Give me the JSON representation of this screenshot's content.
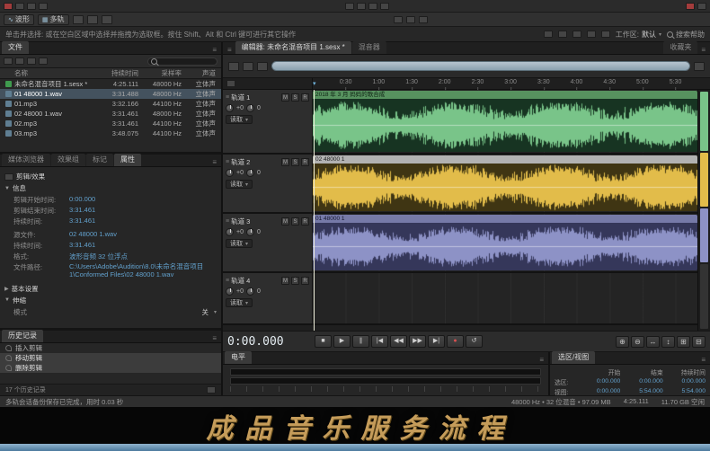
{
  "icons": {
    "menu": "≡",
    "dropdown": "▾",
    "tri_open": "▼",
    "tri_closed": "▶",
    "stop": "■",
    "play": "▶",
    "pause": "∥",
    "skip_back": "|◀",
    "rewind": "◀◀",
    "forward": "▶▶",
    "skip_end": "▶|",
    "record": "●",
    "loop": "↺",
    "zoom_in": "⊕",
    "zoom_out": "⊖",
    "zoom_h": "↔",
    "zoom_v": "↕",
    "zoom_sel_in": "⊞",
    "zoom_sel_out": "⊟",
    "cti_marker": "▾",
    "waveform_glyph": "∿"
  },
  "topbar": {
    "waveform_label": "波形",
    "multitrack_label": "多轨"
  },
  "instruction_bar": {
    "text": "单击并选择: 或在空白区域中选择并拖拽为选取框。按住 Shift、Alt 和 Ctrl 键可进行其它操作",
    "workspace_label": "工作区:",
    "workspace_value": "默认",
    "search_help": "搜索帮助"
  },
  "files_panel": {
    "tab": "文件",
    "columns": {
      "name": "名称",
      "duration": "持续时间",
      "rate": "采样率",
      "channels": "声道"
    },
    "rows": [
      {
        "name": "未命名混音项目 1.sesx *",
        "duration": "4:25.111",
        "rate": "48000 Hz",
        "channels": "立体声"
      },
      {
        "name": "01 48000 1.wav",
        "duration": "3:31.488",
        "rate": "48000 Hz",
        "channels": "立体声"
      },
      {
        "name": "01.mp3",
        "duration": "3:32.166",
        "rate": "44100 Hz",
        "channels": "立体声"
      },
      {
        "name": "02 48000 1.wav",
        "duration": "3:31.461",
        "rate": "48000 Hz",
        "channels": "立体声"
      },
      {
        "name": "02.mp3",
        "duration": "3:31.461",
        "rate": "44100 Hz",
        "channels": "立体声"
      },
      {
        "name": "03.mp3",
        "duration": "3:48.075",
        "rate": "44100 Hz",
        "channels": "立体声"
      }
    ]
  },
  "properties_panel": {
    "tabs": [
      "媒体浏览器",
      "效果组",
      "标记",
      "属性"
    ],
    "header": "剪辑/效果",
    "info_section": "信息",
    "fields": {
      "clip_start_label": "剪辑开始时间:",
      "clip_start": "0:00.000",
      "clip_end_label": "剪辑结束时间:",
      "clip_end": "3:31.461",
      "clip_dur_label": "持续时间:",
      "clip_dur": "3:31.461",
      "source_label": "源文件:",
      "source": "02 48000 1.wav",
      "src_dur_label": "持续时间:",
      "src_dur": "3:31.461",
      "format_label": "格式:",
      "format": "波形音频 32 位浮点",
      "path_label": "文件路径:",
      "path": "C:\\Users\\Adobe\\Audition\\8.0\\未命名混音项目 1\\Conformed Files\\02 48000 1.wav"
    },
    "basic_section": "基本设置",
    "stretch_section": "伸缩",
    "mode_label": "模式",
    "mode_value": "关"
  },
  "history_panel": {
    "tab": "历史记录",
    "items": [
      "插入剪辑",
      "移动剪辑",
      "删除剪辑"
    ],
    "footer": "17 个历史记录"
  },
  "editor": {
    "tab_editor": "编辑器: 未命名混音项目 1.sesx *",
    "tab_mixer": "混音器",
    "tab_favorites": "收藏夹",
    "ruler_ticks": [
      "0:30",
      "1:00",
      "1:30",
      "2:00",
      "2:30",
      "3:00",
      "3:30",
      "4:00",
      "4:30",
      "5:00",
      "5:30"
    ],
    "msr": [
      "M",
      "S",
      "R"
    ],
    "tracks": [
      {
        "name": "轨道 1",
        "vol": "+0",
        "pan": "0",
        "mode": "读取",
        "clip": "2018 年 3 月 妈妈的歌合成",
        "colors": {
          "clip_bg": "#173422",
          "header_bg": "#57925f",
          "header_text": "#0e2213",
          "wave": "#79c489"
        }
      },
      {
        "name": "轨道 2",
        "vol": "+0",
        "pan": "0",
        "mode": "读取",
        "clip": "02 48000 1",
        "colors": {
          "clip_bg": "#3f3513",
          "header_bg": "#b2b2b2",
          "header_text": "#1c1c1c",
          "wave": "#e2bc4a"
        }
      },
      {
        "name": "轨道 3",
        "vol": "+0",
        "pan": "0",
        "mode": "读取",
        "clip": "01 48000 1",
        "colors": {
          "clip_bg": "#35375a",
          "header_bg": "#767aa8",
          "header_text": "#15172e",
          "wave": "#8d92c6"
        }
      },
      {
        "name": "轨道 4",
        "vol": "+0",
        "pan": "0",
        "mode": "读取",
        "clip": "",
        "colors": {
          "clip_bg": "",
          "header_bg": "",
          "header_text": "",
          "wave": "#4e8f5c"
        }
      }
    ],
    "transport_time": "0:00.000"
  },
  "levels_panel": {
    "tab": "电平"
  },
  "selection_panel": {
    "tab": "选区/视图",
    "columns": [
      "开始",
      "结束",
      "持续时间"
    ],
    "rows": [
      {
        "label": "选区:",
        "start": "0:00.000",
        "end": "0:00.000",
        "dur": "0:00.000"
      },
      {
        "label": "视图:",
        "start": "0:00.000",
        "end": "5:54.000",
        "dur": "5:54.000"
      }
    ]
  },
  "status_bar": {
    "left": "多轨会话备份保存已完成，用时 0.03 秒",
    "format": "48000 Hz • 32 位混音 • 97.09 MB",
    "position": "4:25.111",
    "free": "11.70 GB 空闲"
  },
  "banner": {
    "text": "成品音乐服务流程"
  }
}
